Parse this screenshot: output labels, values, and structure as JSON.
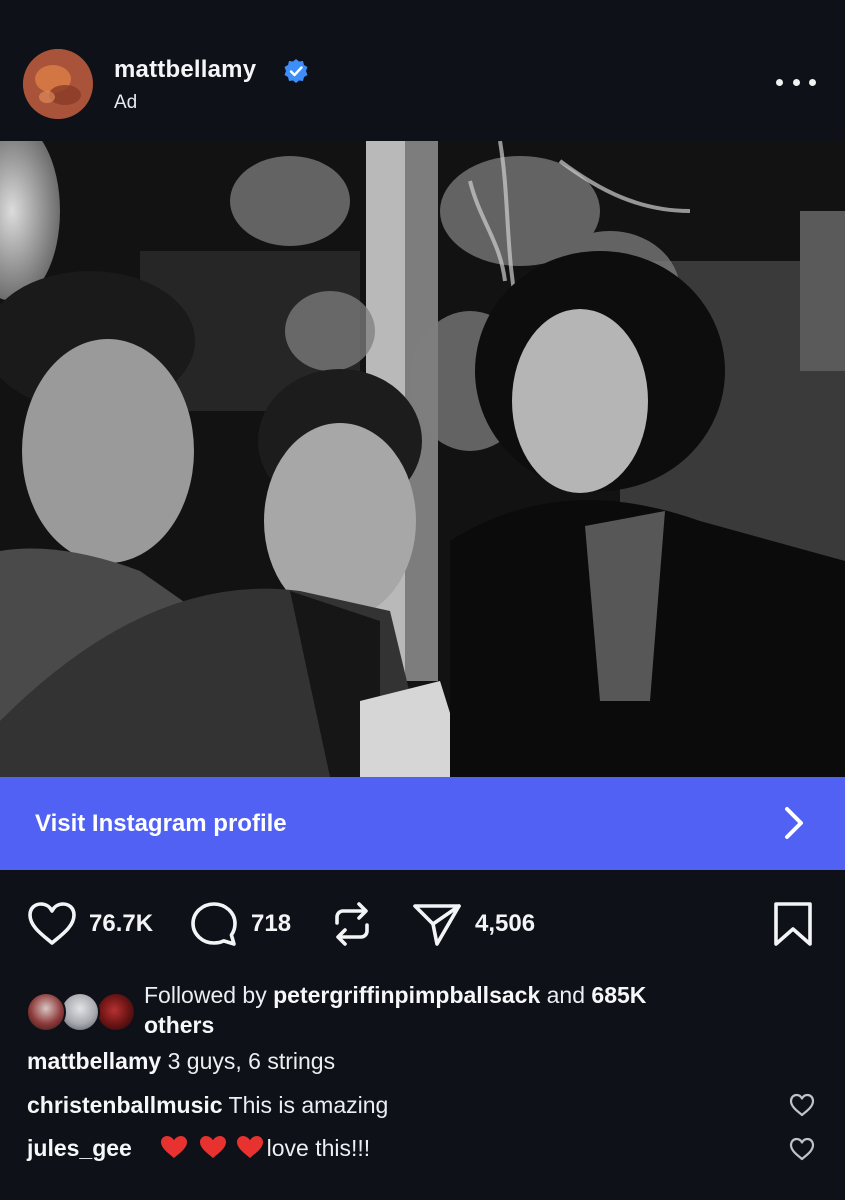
{
  "post": {
    "username": "mattbellamy",
    "sponsored_label": "Ad",
    "verified": true
  },
  "cta": {
    "label": "Visit Instagram profile"
  },
  "actions": {
    "likes": "76.7K",
    "comments": "718",
    "shares": "4,506"
  },
  "social_proof": {
    "prefix": "Followed by ",
    "follower": "petergriffinpimpballsack",
    "middle": " and ",
    "count": "685K",
    "suffix_line2": "others"
  },
  "caption": {
    "author": "mattbellamy",
    "text": " 3 guys, 6 strings"
  },
  "comments": [
    {
      "author": "christenballmusic",
      "text": " This is amazing"
    },
    {
      "author": "jules_gee",
      "text": "love this!!!"
    }
  ],
  "icons": {
    "verified": "verified-badge-icon",
    "more": "more-options-icon",
    "like": "heart-icon",
    "comment": "comment-bubble-icon",
    "repost": "repost-icon",
    "share": "paper-plane-icon",
    "save": "bookmark-icon",
    "cta_arrow": "chevron-right-icon",
    "comment_like": "heart-outline-icon"
  },
  "colors": {
    "background": "#0e1117",
    "cta": "#5061f4",
    "verified": "#3d8ef7",
    "emoji_heart": "#e8322f"
  }
}
